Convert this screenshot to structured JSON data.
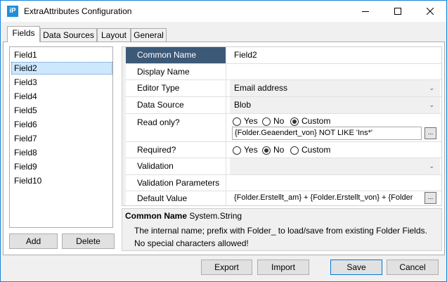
{
  "window": {
    "title": "ExtraAttributes Configuration",
    "icon_text": "iP"
  },
  "tabs": [
    {
      "label": "Fields",
      "active": true
    },
    {
      "label": "Data Sources",
      "active": false
    },
    {
      "label": "Layout",
      "active": false
    },
    {
      "label": "General",
      "active": false
    }
  ],
  "fields": {
    "items": [
      "Field1",
      "Field2",
      "Field3",
      "Field4",
      "Field5",
      "Field6",
      "Field7",
      "Field8",
      "Field9",
      "Field10"
    ],
    "selected": "Field2",
    "add_label": "Add",
    "delete_label": "Delete"
  },
  "properties": {
    "common_name": {
      "label": "Common Name",
      "value": "Field2"
    },
    "display_name": {
      "label": "Display Name",
      "value": ""
    },
    "editor_type": {
      "label": "Editor Type",
      "value": "Email address"
    },
    "data_source": {
      "label": "Data Source",
      "value": "Blob"
    },
    "read_only": {
      "label": "Read only?",
      "options": [
        "Yes",
        "No",
        "Custom"
      ],
      "selected": "Custom",
      "expression": "{Folder.Geaendert_von}  NOT   LIKE 'Ins*'"
    },
    "required": {
      "label": "Required?",
      "options": [
        "Yes",
        "No",
        "Custom"
      ],
      "selected": "No"
    },
    "validation": {
      "label": "Validation",
      "value": ""
    },
    "validation_parameters": {
      "label": "Validation Parameters",
      "value": ""
    },
    "default_value": {
      "label": "Default Value",
      "value": "{Folder.Erstellt_am} + {Folder.Erstellt_von} + {Folder"
    },
    "ellipsis": "..."
  },
  "description": {
    "name": "Common Name",
    "type": "System.String",
    "line1": "The internal name; prefix with Folder_ to load/save from existing Folder Fields.",
    "line2": "No special characters allowed!"
  },
  "footer": {
    "export_label": "Export",
    "import_label": "Import",
    "save_label": "Save",
    "cancel_label": "Cancel"
  },
  "colors": {
    "header_row_bg": "#3c5a78",
    "selection_bg": "#cce8ff",
    "app_icon_bg": "#1e8fd8",
    "window_border": "#1883d7"
  }
}
